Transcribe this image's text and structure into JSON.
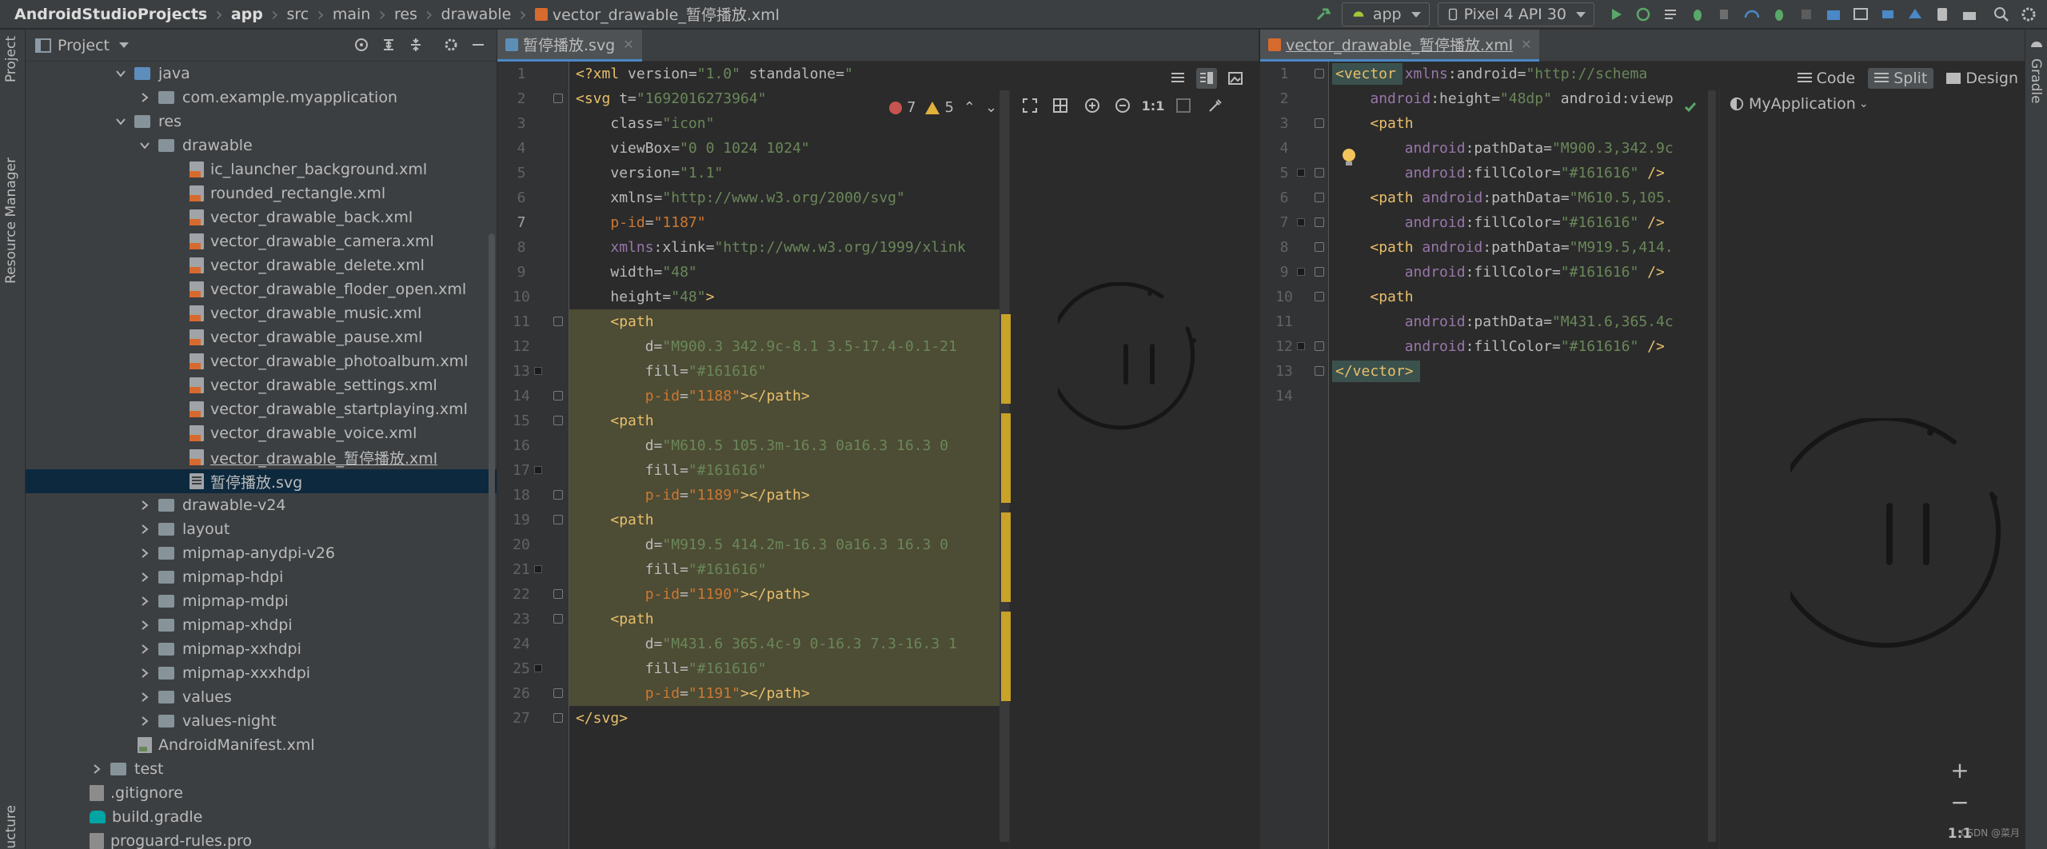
{
  "breadcrumb": [
    "AndroidStudioProjects",
    "app",
    "src",
    "main",
    "res",
    "drawable",
    "vector_drawable_暂停播放.xml"
  ],
  "toolbar": {
    "run_config": "app",
    "device": "Pixel 4 API 30"
  },
  "left_strip": {
    "project_tab": "Project",
    "resource_manager_tab": "Resource Manager",
    "structure_tab": "ucture"
  },
  "right_strip": {
    "gradle_tab": "Gradle"
  },
  "project_panel": {
    "title": "Project",
    "tree": [
      {
        "label": "java",
        "type": "folder-blue",
        "expanded": true
      },
      {
        "label": "com.example.myapplication",
        "type": "package",
        "expanded": false
      },
      {
        "label": "res",
        "type": "folder-res",
        "expanded": true
      },
      {
        "label": "drawable",
        "type": "folder",
        "expanded": true
      },
      {
        "label": "ic_launcher_background.xml",
        "type": "xml"
      },
      {
        "label": "rounded_rectangle.xml",
        "type": "xml"
      },
      {
        "label": "vector_drawable_back.xml",
        "type": "xml"
      },
      {
        "label": "vector_drawable_camera.xml",
        "type": "xml"
      },
      {
        "label": "vector_drawable_delete.xml",
        "type": "xml"
      },
      {
        "label": "vector_drawable_floder_open.xml",
        "type": "xml"
      },
      {
        "label": "vector_drawable_music.xml",
        "type": "xml"
      },
      {
        "label": "vector_drawable_pause.xml",
        "type": "xml"
      },
      {
        "label": "vector_drawable_photoalbum.xml",
        "type": "xml"
      },
      {
        "label": "vector_drawable_settings.xml",
        "type": "xml"
      },
      {
        "label": "vector_drawable_startplaying.xml",
        "type": "xml"
      },
      {
        "label": "vector_drawable_voice.xml",
        "type": "xml"
      },
      {
        "label": "vector_drawable_暂停播放.xml",
        "type": "xml"
      },
      {
        "label": "暂停播放.svg",
        "type": "svg",
        "selected": true
      },
      {
        "label": "drawable-v24",
        "type": "folder",
        "expanded": false
      },
      {
        "label": "layout",
        "type": "folder",
        "expanded": false
      },
      {
        "label": "mipmap-anydpi-v26",
        "type": "folder",
        "expanded": false
      },
      {
        "label": "mipmap-hdpi",
        "type": "folder",
        "expanded": false
      },
      {
        "label": "mipmap-mdpi",
        "type": "folder",
        "expanded": false
      },
      {
        "label": "mipmap-xhdpi",
        "type": "folder",
        "expanded": false
      },
      {
        "label": "mipmap-xxhdpi",
        "type": "folder",
        "expanded": false
      },
      {
        "label": "mipmap-xxxhdpi",
        "type": "folder",
        "expanded": false
      },
      {
        "label": "values",
        "type": "folder",
        "expanded": false
      },
      {
        "label": "values-night",
        "type": "folder",
        "expanded": false
      },
      {
        "label": "AndroidManifest.xml",
        "type": "manifest"
      },
      {
        "label": "test",
        "type": "folder",
        "expanded": false
      },
      {
        "label": ".gitignore",
        "type": "git"
      },
      {
        "label": "build.gradle",
        "type": "gradle"
      },
      {
        "label": "proguard-rules.pro",
        "type": "git"
      }
    ]
  },
  "svg_editor": {
    "tab_label": "暂停播放.svg",
    "error_count": "7",
    "warning_count": "5",
    "zoom_1to1": "1:1",
    "lines": [
      "<?xml version=\"1.0\" standalone=\"",
      "<svg t=\"1692016273964\"",
      "    class=\"icon\"",
      "    viewBox=\"0 0 1024 1024\"",
      "    version=\"1.1\"",
      "    xmlns=\"http://www.w3.org/2000/svg\"",
      "    p-id=\"1187\"",
      "    xmlns:xlink=\"http://www.w3.org/1999/xlink",
      "    width=\"48\"",
      "    height=\"48\">",
      "    <path",
      "        d=\"M900.3 342.9c-8.1 3.5-17.4-0.1-21",
      "        fill=\"#161616\"",
      "        p-id=\"1188\"></path>",
      "    <path",
      "        d=\"M610.5 105.3m-16.3 0a16.3 16.3 0",
      "        fill=\"#161616\"",
      "        p-id=\"1189\"></path>",
      "    <path",
      "        d=\"M919.5 414.2m-16.3 0a16.3 16.3 0",
      "        fill=\"#161616\"",
      "        p-id=\"1190\"></path>",
      "    <path",
      "        d=\"M431.6 365.4c-9 0-16.3 7.3-16.3 1",
      "        fill=\"#161616\"",
      "        p-id=\"1191\"></path>",
      "</svg>"
    ]
  },
  "xml_editor": {
    "tab_label": "vector_drawable_暂停播放.xml",
    "mode_code": "Code",
    "mode_split": "Split",
    "mode_design": "Design",
    "preview_theme": "MyApplication",
    "zoom_fit": "1:1",
    "lines": [
      "<vector xmlns:android=\"http://schema",
      "    android:height=\"48dp\" android:viewp",
      "    <path",
      "        android:pathData=\"M900.3,342.9c",
      "        android:fillColor=\"#161616\" />",
      "    <path android:pathData=\"M610.5,105.",
      "        android:fillColor=\"#161616\" />",
      "    <path android:pathData=\"M919.5,414.",
      "        android:fillColor=\"#161616\" />",
      "    <path",
      "        android:pathData=\"M431.6,365.4c",
      "        android:fillColor=\"#161616\" />",
      "</vector>",
      ""
    ]
  },
  "watermark": "CSDN @菜月",
  "colors": {
    "tag": "#e8bf6a",
    "string": "#6a8759",
    "attr": "#bababa",
    "pid": "#cc7832",
    "namespace": "#9876aa",
    "selection": "#0d293e",
    "icon_stroke": "#161616"
  }
}
